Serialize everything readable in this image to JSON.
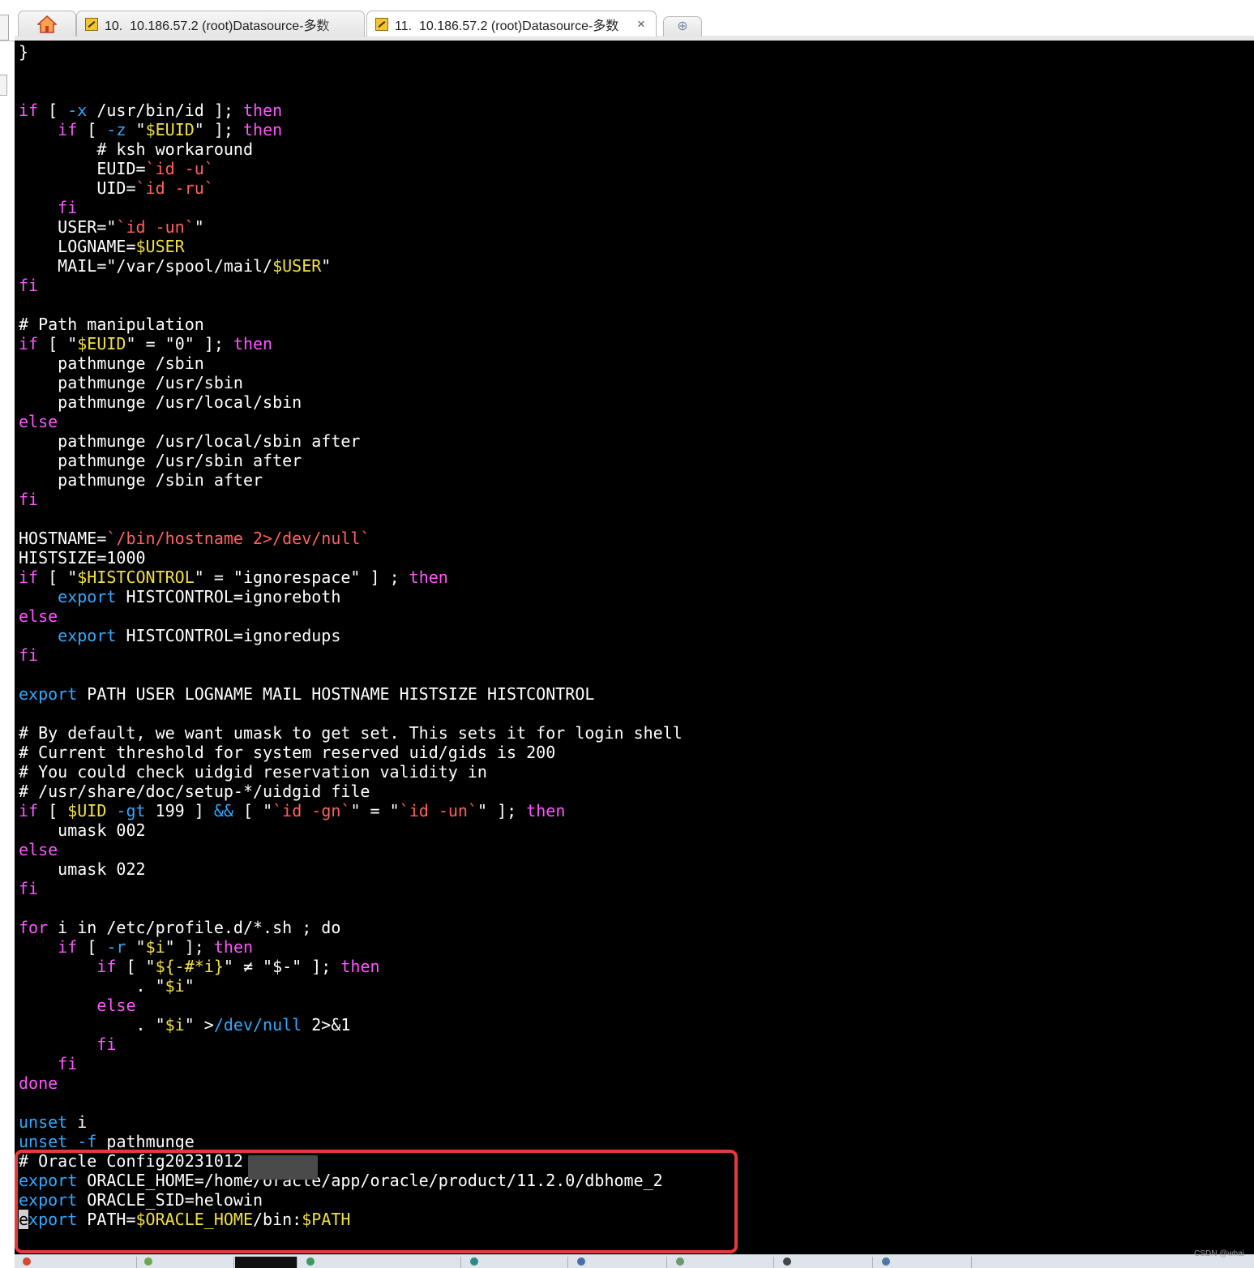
{
  "tabs": [
    {
      "name": "tab-session-10",
      "number": "10.",
      "title": "10.186.57.2  (root)Datasource-多数",
      "active": false
    },
    {
      "name": "tab-session-11",
      "number": "11.",
      "title": "10.186.57.2  (root)Datasource-多数",
      "active": true
    }
  ],
  "colors": {
    "background": "#000000",
    "text": "#ffffff",
    "keyword": "#ff55ff",
    "operator": "#33a8ff",
    "variable": "#f2e040",
    "command_sub": "#ff6161",
    "highlight_border": "#e23b3b"
  },
  "terminal": {
    "lines": [
      [
        [
          "}",
          "t"
        ]
      ],
      [],
      [],
      [
        [
          "if",
          "kw"
        ],
        [
          " [ ",
          "t"
        ],
        [
          "-x",
          "op"
        ],
        [
          " /usr/bin/id ]; ",
          "t"
        ],
        [
          "then",
          "kw"
        ]
      ],
      [
        [
          "    ",
          "t"
        ],
        [
          "if",
          "kw"
        ],
        [
          " [ ",
          "t"
        ],
        [
          "-z",
          "op"
        ],
        [
          " \"",
          "t"
        ],
        [
          "$EUID",
          "var"
        ],
        [
          "\" ]; ",
          "t"
        ],
        [
          "then",
          "kw"
        ]
      ],
      [
        [
          "        # ksh workaround",
          "t"
        ]
      ],
      [
        [
          "        EUID=",
          "t"
        ],
        [
          "`id -u`",
          "cmd"
        ]
      ],
      [
        [
          "        UID=",
          "t"
        ],
        [
          "`id -ru`",
          "cmd"
        ]
      ],
      [
        [
          "    ",
          "t"
        ],
        [
          "fi",
          "kw"
        ]
      ],
      [
        [
          "    USER=\"",
          "t"
        ],
        [
          "`id -un`",
          "cmd"
        ],
        [
          "\"",
          "t"
        ]
      ],
      [
        [
          "    LOGNAME=",
          "t"
        ],
        [
          "$USER",
          "var"
        ]
      ],
      [
        [
          "    MAIL=\"/var/spool/mail/",
          "t"
        ],
        [
          "$USER",
          "var"
        ],
        [
          "\"",
          "t"
        ]
      ],
      [
        [
          "fi",
          "kw"
        ]
      ],
      [],
      [
        [
          "# Path manipulation",
          "t"
        ]
      ],
      [
        [
          "if",
          "kw"
        ],
        [
          " [ \"",
          "t"
        ],
        [
          "$EUID",
          "var"
        ],
        [
          "\" = \"0\" ]; ",
          "t"
        ],
        [
          "then",
          "kw"
        ]
      ],
      [
        [
          "    pathmunge /sbin",
          "t"
        ]
      ],
      [
        [
          "    pathmunge /usr/sbin",
          "t"
        ]
      ],
      [
        [
          "    pathmunge /usr/local/sbin",
          "t"
        ]
      ],
      [
        [
          "else",
          "kw"
        ]
      ],
      [
        [
          "    pathmunge /usr/local/sbin after",
          "t"
        ]
      ],
      [
        [
          "    pathmunge /usr/sbin after",
          "t"
        ]
      ],
      [
        [
          "    pathmunge /sbin after",
          "t"
        ]
      ],
      [
        [
          "fi",
          "kw"
        ]
      ],
      [],
      [
        [
          "HOSTNAME=",
          "t"
        ],
        [
          "`/bin/hostname 2>/dev/null`",
          "cmd"
        ]
      ],
      [
        [
          "HISTSIZE=1000",
          "t"
        ]
      ],
      [
        [
          "if",
          "kw"
        ],
        [
          " [ \"",
          "t"
        ],
        [
          "$HISTCONTROL",
          "var"
        ],
        [
          "\" = \"ignorespace\" ] ; ",
          "t"
        ],
        [
          "then",
          "kw"
        ]
      ],
      [
        [
          "    ",
          "t"
        ],
        [
          "export",
          "op"
        ],
        [
          " HISTCONTROL=ignoreboth",
          "t"
        ]
      ],
      [
        [
          "else",
          "kw"
        ]
      ],
      [
        [
          "    ",
          "t"
        ],
        [
          "export",
          "op"
        ],
        [
          " HISTCONTROL=ignoredups",
          "t"
        ]
      ],
      [
        [
          "fi",
          "kw"
        ]
      ],
      [],
      [
        [
          "export",
          "op"
        ],
        [
          " PATH USER LOGNAME MAIL HOSTNAME HISTSIZE HISTCONTROL",
          "t"
        ]
      ],
      [],
      [
        [
          "# By default, we want umask to get set. This sets it for login shell",
          "t"
        ]
      ],
      [
        [
          "# Current threshold for system reserved uid/gids is 200",
          "t"
        ]
      ],
      [
        [
          "# You could check uidgid reservation validity in",
          "t"
        ]
      ],
      [
        [
          "# /usr/share/doc/setup-*/uidgid file",
          "t"
        ]
      ],
      [
        [
          "if",
          "kw"
        ],
        [
          " [ ",
          "t"
        ],
        [
          "$UID",
          "var"
        ],
        [
          " ",
          "t"
        ],
        [
          "-gt",
          "op"
        ],
        [
          " 199 ] ",
          "t"
        ],
        [
          "&&",
          "op"
        ],
        [
          " [ \"",
          "t"
        ],
        [
          "`id -gn`",
          "cmd"
        ],
        [
          "\" = \"",
          "t"
        ],
        [
          "`id -un`",
          "cmd"
        ],
        [
          "\" ]; ",
          "t"
        ],
        [
          "then",
          "kw"
        ]
      ],
      [
        [
          "    umask 002",
          "t"
        ]
      ],
      [
        [
          "else",
          "kw"
        ]
      ],
      [
        [
          "    umask 022",
          "t"
        ]
      ],
      [
        [
          "fi",
          "kw"
        ]
      ],
      [],
      [
        [
          "for",
          "kw"
        ],
        [
          " i in /etc/profile.d/*.sh ; do",
          "t"
        ]
      ],
      [
        [
          "    ",
          "t"
        ],
        [
          "if",
          "kw"
        ],
        [
          " [ ",
          "t"
        ],
        [
          "-r",
          "op"
        ],
        [
          " \"",
          "t"
        ],
        [
          "$i",
          "var"
        ],
        [
          "\" ]; ",
          "t"
        ],
        [
          "then",
          "kw"
        ]
      ],
      [
        [
          "        ",
          "t"
        ],
        [
          "if",
          "kw"
        ],
        [
          " [ \"",
          "t"
        ],
        [
          "${-#*i}",
          "var"
        ],
        [
          "\" ≠ \"$-\" ]; ",
          "t"
        ],
        [
          "then",
          "kw"
        ]
      ],
      [
        [
          "            . \"",
          "t"
        ],
        [
          "$i",
          "var"
        ],
        [
          "\"",
          "t"
        ]
      ],
      [
        [
          "        ",
          "t"
        ],
        [
          "else",
          "kw"
        ]
      ],
      [
        [
          "            . \"",
          "t"
        ],
        [
          "$i",
          "var"
        ],
        [
          "\" >",
          "t"
        ],
        [
          "/dev/null",
          "op"
        ],
        [
          " 2>&1",
          "t"
        ]
      ],
      [
        [
          "        ",
          "t"
        ],
        [
          "fi",
          "kw"
        ]
      ],
      [
        [
          "    ",
          "t"
        ],
        [
          "fi",
          "kw"
        ]
      ],
      [
        [
          "done",
          "kw"
        ]
      ],
      [],
      [
        [
          "unset",
          "op"
        ],
        [
          " i",
          "t"
        ]
      ],
      [
        [
          "unset",
          "op"
        ],
        [
          " ",
          "t"
        ],
        [
          "-f",
          "op"
        ],
        [
          " pathmunge",
          "t"
        ]
      ],
      [
        [
          "# Oracle Config20231012",
          "t"
        ]
      ],
      [
        [
          "export",
          "op"
        ],
        [
          " ORACLE_HOME=/home/oracle/app/oracle/product/11.2.0/dbhome_2",
          "t"
        ]
      ],
      [
        [
          "export",
          "op"
        ],
        [
          " ORACLE_SID=helowin",
          "t"
        ]
      ],
      [
        [
          "e",
          "cursor"
        ],
        [
          "xport",
          "op"
        ],
        [
          " PATH=",
          "t"
        ],
        [
          "$ORACLE_HOME",
          "var"
        ],
        [
          "/bin:",
          "t"
        ],
        [
          "$PATH",
          "var"
        ]
      ]
    ]
  },
  "watermark": "CSDN @whai"
}
